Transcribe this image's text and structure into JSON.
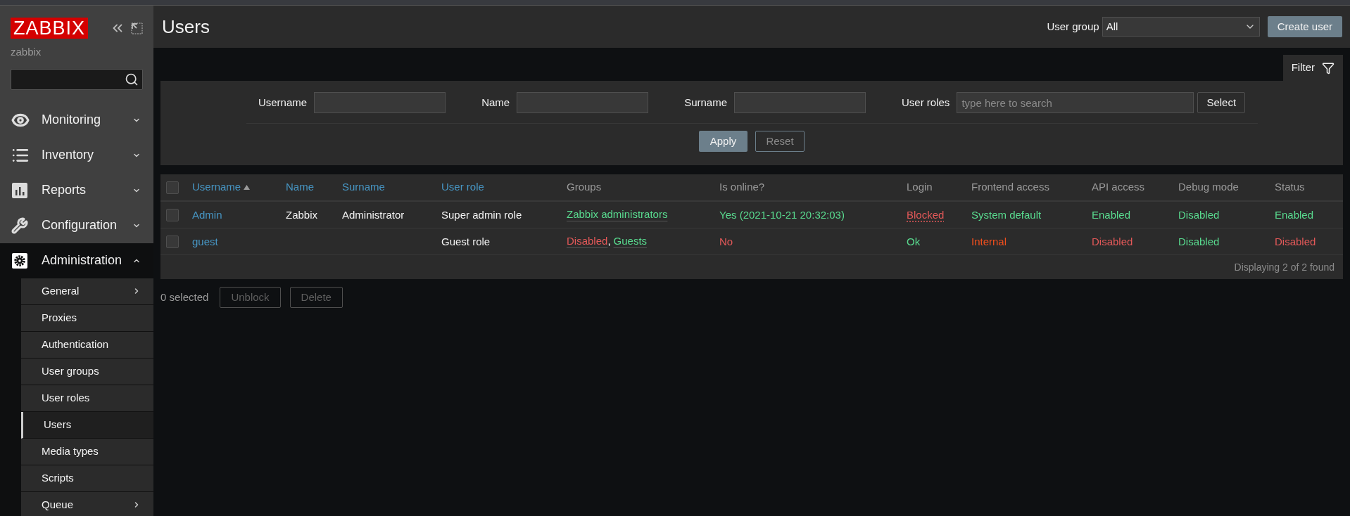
{
  "sidebar": {
    "logo": "ZABBIX",
    "server_name": "zabbix",
    "menu": [
      {
        "label": "Monitoring",
        "kind": "eye",
        "expanded": false,
        "selected": false
      },
      {
        "label": "Inventory",
        "kind": "list",
        "expanded": false,
        "selected": false
      },
      {
        "label": "Reports",
        "kind": "chart",
        "expanded": false,
        "selected": false
      },
      {
        "label": "Configuration",
        "kind": "wrench",
        "expanded": false,
        "selected": false
      },
      {
        "label": "Administration",
        "kind": "gear",
        "expanded": true,
        "selected": true,
        "children": [
          {
            "label": "General",
            "selected": false,
            "has_submenu": true
          },
          {
            "label": "Proxies",
            "selected": false,
            "has_submenu": false
          },
          {
            "label": "Authentication",
            "selected": false,
            "has_submenu": false
          },
          {
            "label": "User groups",
            "selected": false,
            "has_submenu": false
          },
          {
            "label": "User roles",
            "selected": false,
            "has_submenu": false
          },
          {
            "label": "Users",
            "selected": true,
            "has_submenu": false
          },
          {
            "label": "Media types",
            "selected": false,
            "has_submenu": false
          },
          {
            "label": "Scripts",
            "selected": false,
            "has_submenu": false
          },
          {
            "label": "Queue",
            "selected": false,
            "has_submenu": true
          }
        ]
      }
    ]
  },
  "header": {
    "title": "Users",
    "user_group": {
      "label": "User group",
      "value": "All"
    },
    "create_button": "Create user"
  },
  "filter": {
    "tab_label": "Filter",
    "expanded": true,
    "fields": [
      {
        "label": "Username"
      },
      {
        "label": "Name"
      },
      {
        "label": "Surname"
      },
      {
        "label": "User roles",
        "placeholder": "type here to search",
        "button": "Select"
      }
    ],
    "apply": "Apply",
    "reset": "Reset"
  },
  "table": {
    "all_checked": false,
    "columns": [
      {
        "label": "Username",
        "sortable": true,
        "sorted": true
      },
      {
        "label": "Name",
        "sortable": true,
        "sorted": false
      },
      {
        "label": "Surname",
        "sortable": true,
        "sorted": false
      },
      {
        "label": "User role",
        "sortable": true,
        "sorted": false
      },
      {
        "label": "Groups",
        "sortable": false,
        "sorted": false
      },
      {
        "label": "Is online?",
        "sortable": false,
        "sorted": false
      },
      {
        "label": "Login",
        "sortable": false,
        "sorted": false
      },
      {
        "label": "Frontend access",
        "sortable": false,
        "sorted": false
      },
      {
        "label": "API access",
        "sortable": false,
        "sorted": false
      },
      {
        "label": "Debug mode",
        "sortable": false,
        "sorted": false
      },
      {
        "label": "Status",
        "sortable": false,
        "sorted": false
      }
    ],
    "rows": [
      {
        "selected": false,
        "cells": [
          {
            "kind": "link",
            "text": "Admin",
            "color": "#4796c4"
          },
          {
            "kind": "text",
            "text": "Zabbix",
            "color": "#f2f2f2"
          },
          {
            "kind": "text",
            "text": "Administrator",
            "color": "#f2f2f2"
          },
          {
            "kind": "text",
            "text": "Super admin role",
            "color": "#f2f2f2"
          },
          {
            "kind": "groups",
            "items": [
              {
                "text": "Zabbix administrators",
                "color": "#59db8f"
              }
            ]
          },
          {
            "kind": "text",
            "text": "Yes (2021-10-21 20:32:03)",
            "color": "#59db8f"
          },
          {
            "kind": "hint",
            "text": "Blocked",
            "color": "#e45959"
          },
          {
            "kind": "text",
            "text": "System default",
            "color": "#59db8f"
          },
          {
            "kind": "text",
            "text": "Enabled",
            "color": "#59db8f"
          },
          {
            "kind": "text",
            "text": "Disabled",
            "color": "#59db8f"
          },
          {
            "kind": "text",
            "text": "Enabled",
            "color": "#59db8f"
          }
        ]
      },
      {
        "selected": false,
        "cells": [
          {
            "kind": "link",
            "text": "guest",
            "color": "#4796c4"
          },
          {
            "kind": "empty"
          },
          {
            "kind": "empty"
          },
          {
            "kind": "text",
            "text": "Guest role",
            "color": "#f2f2f2"
          },
          {
            "kind": "groups",
            "separator": ",",
            "items": [
              {
                "text": "Disabled",
                "color": "#e45959"
              },
              {
                "text": "Guests",
                "color": "#59db8f"
              }
            ]
          },
          {
            "kind": "text",
            "text": "No",
            "color": "#e45959"
          },
          {
            "kind": "text",
            "text": "Ok",
            "color": "#59db8f"
          },
          {
            "kind": "text",
            "text": "Internal",
            "color": "#f24f1d"
          },
          {
            "kind": "text",
            "text": "Disabled",
            "color": "#e45959"
          },
          {
            "kind": "text",
            "text": "Disabled",
            "color": "#59db8f"
          },
          {
            "kind": "text",
            "text": "Disabled",
            "color": "#e45959"
          }
        ]
      }
    ],
    "summary": "Displaying 2 of 2 found"
  },
  "footer": {
    "selected_count": "0 selected",
    "actions": [
      {
        "label": "Unblock",
        "disabled": true
      },
      {
        "label": "Delete",
        "disabled": true
      }
    ]
  }
}
